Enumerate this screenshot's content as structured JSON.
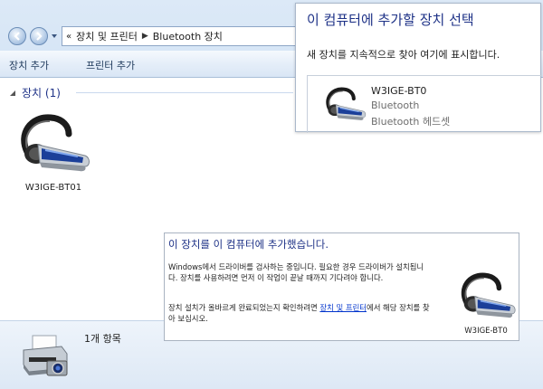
{
  "address": {
    "breadcrumb": [
      "장치 및 프린터",
      "Bluetooth 장치"
    ]
  },
  "toolbar": {
    "add_device": "장치 추가",
    "add_printer": "프린터 추가"
  },
  "group": {
    "title": "장치 (1)"
  },
  "devices": [
    {
      "name": "W3IGE-BT01",
      "icon": "bluetooth-headset-icon"
    }
  ],
  "status": {
    "count": "1개 항목",
    "icon": "printer-camera-icon"
  },
  "select_panel": {
    "title": "이 컴퓨터에 추가할 장치 선택",
    "description": "새 장치를 지속적으로 찾아 여기에 표시합니다.",
    "device": {
      "name": "W3IGE-BT0",
      "type": "Bluetooth",
      "subtype": "Bluetooth 헤드셋"
    }
  },
  "notification": {
    "title": "이 장치를 이 컴퓨터에 추가했습니다.",
    "body1": "Windows에서 드라이버를 검사하는 중입니다. 필요한 경우 드라이버가 설치됩니다. 장치를 사용하려면 먼저 이 작업이 끝날 때까지 기다려야 합니다.",
    "body2_pre": "장치 설치가 올바르게 완료되었는지 확인하려면 ",
    "body2_link": "장치 및 프린터",
    "body2_post": "에서 해당 장치를 찾아 보십시오.",
    "device_name": "W3IGE-BT0"
  },
  "colors": {
    "accent": "#1e3287",
    "link": "#0033cc"
  }
}
